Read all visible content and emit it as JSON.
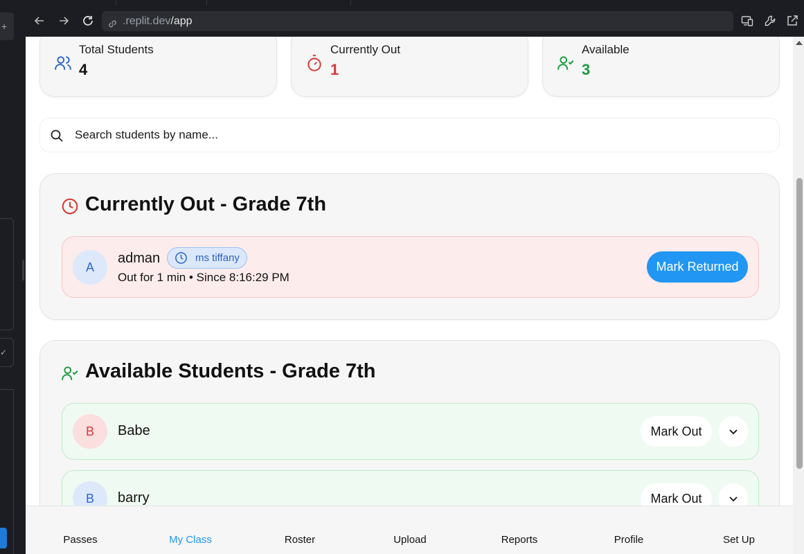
{
  "browser": {
    "url_dim": ".replit.dev",
    "url_path": "/app"
  },
  "stats": [
    {
      "label": "Total Students",
      "value": "4",
      "icon": "users-icon",
      "color": "#111111"
    },
    {
      "label": "Currently Out",
      "value": "1",
      "icon": "timer-icon",
      "color": "#d23a3a"
    },
    {
      "label": "Available",
      "value": "3",
      "icon": "user-check-icon",
      "color": "#1a9a3f"
    }
  ],
  "search": {
    "placeholder": "Search students by name..."
  },
  "currently_out": {
    "title": "Currently Out - Grade 7th",
    "students": [
      {
        "initial": "A",
        "name": "adman",
        "teacher": "ms tiffany",
        "meta": "Out for 1 min • Since 8:16:29 PM",
        "action": "Mark Returned"
      }
    ]
  },
  "available": {
    "title": "Available Students - Grade 7th",
    "students": [
      {
        "initial": "B",
        "name": "Babe",
        "action": "Mark Out"
      },
      {
        "initial": "B",
        "name": "barry",
        "action": "Mark Out"
      }
    ]
  },
  "bottom_nav": {
    "items": [
      "Passes",
      "My Class",
      "Roster",
      "Upload",
      "Reports",
      "Profile",
      "Set Up"
    ],
    "active": "My Class"
  },
  "colors": {
    "accent": "#2196f3",
    "out_red": "#d23a3a",
    "available_green": "#1a9a3f"
  }
}
